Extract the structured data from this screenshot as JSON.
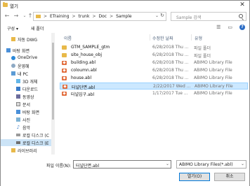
{
  "window": {
    "title": "열기"
  },
  "address": {
    "crumbs": [
      "ETraining",
      "trunk",
      "Doc",
      "Sample"
    ],
    "separator": ">"
  },
  "search": {
    "placeholder": "Sample 검색"
  },
  "commands": {
    "organize": "구성 ▾",
    "new_folder": "새 폴더"
  },
  "nav": {
    "items": [
      {
        "label": "자동 DWG",
        "icon": "folder-icon"
      },
      {
        "label": "바탕 화면",
        "icon": "desktop-icon"
      },
      {
        "label": "OneDrive",
        "icon": "cloud-icon"
      },
      {
        "label": "윤영혜",
        "icon": "user-icon"
      },
      {
        "label": "내 PC",
        "icon": "pc-icon"
      },
      {
        "label": "3D 개체",
        "icon": "cube-icon"
      },
      {
        "label": "다운로드",
        "icon": "download-icon"
      },
      {
        "label": "동영상",
        "icon": "video-icon"
      },
      {
        "label": "문서",
        "icon": "document-icon"
      },
      {
        "label": "바탕 화면",
        "icon": "desktop-icon"
      },
      {
        "label": "사진",
        "icon": "picture-icon"
      },
      {
        "label": "음악",
        "icon": "music-icon"
      },
      {
        "label": "로컬 디스크 (C",
        "icon": "drive-icon"
      },
      {
        "label": "로컬 디스크 (E",
        "icon": "drive-icon"
      },
      {
        "label": "라이브러리",
        "icon": "library-icon"
      }
    ]
  },
  "columns": {
    "name": "이름",
    "date": "수정한 날짜",
    "type": "유형"
  },
  "files": [
    {
      "name": "GTM_SAMPLE_gtm",
      "date": "6/28/2018 Thu ...",
      "type": "파일 폴더",
      "kind": "folder"
    },
    {
      "name": "site_house_obj",
      "date": "6/28/2018 Thu ...",
      "type": "파일 폴더",
      "kind": "folder"
    },
    {
      "name": "building.abl",
      "date": "6/28/2018 Thu ...",
      "type": "ABIMO Library File",
      "kind": "abl"
    },
    {
      "name": "coloumn.abl",
      "date": "6/28/2018 Thu ...",
      "type": "ABIMO Library File",
      "kind": "abl"
    },
    {
      "name": "house.abl",
      "date": "6/28/2018 Thu ...",
      "type": "ABIMO Library File",
      "kind": "abl"
    },
    {
      "name": "터널단면.abl",
      "date": "2/22/2017 Wed ...",
      "type": "ABIMO Library File",
      "kind": "abl"
    },
    {
      "name": "터널입구.abl",
      "date": "1/17/2017 Tue ...",
      "type": "ABIMO Library File",
      "kind": "abl"
    }
  ],
  "selected_file_index": 5,
  "footer": {
    "filename_label": "파일 이름(N):",
    "filename_value": "터널단면.abl",
    "filetype_value": "ABIMO Library Files(*.abl)",
    "open_label": "열기(O)",
    "cancel_label": "취소"
  },
  "colors": {
    "selection": "#cce8ff",
    "selection_border": "#99d1ff",
    "accent": "#0078d7",
    "folder": "#e8b949"
  }
}
